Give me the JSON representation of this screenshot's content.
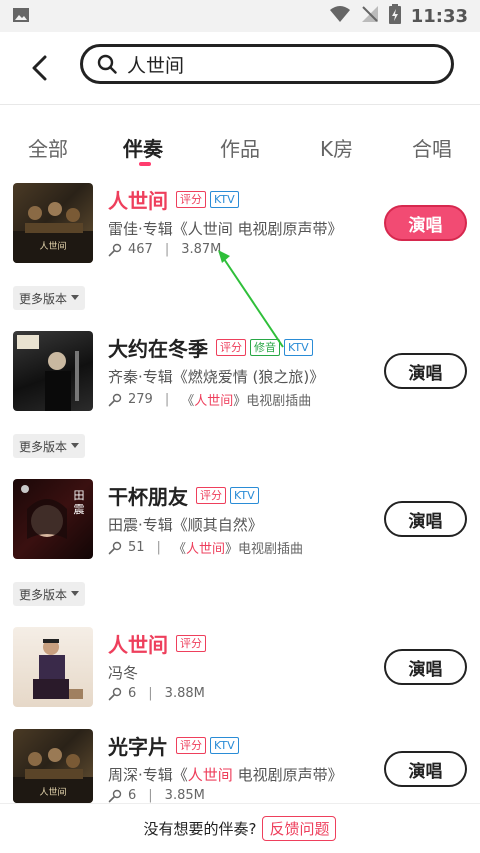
{
  "status_bar": {
    "time": "11:33"
  },
  "search": {
    "query": "人世间"
  },
  "tabs": [
    {
      "label": "全部"
    },
    {
      "label": "伴奏"
    },
    {
      "label": "作品"
    },
    {
      "label": "K房"
    },
    {
      "label": "合唱"
    }
  ],
  "colors": {
    "accent": "#ee3f5c",
    "ktv_blue": "#2a8cd6",
    "fix_green": "#28a745"
  },
  "tags": {
    "score": "评分",
    "ktv": "KTV",
    "fix": "修音"
  },
  "sing_label": "演唱",
  "more_versions_label": "更多版本",
  "songs": [
    {
      "title": "人世间",
      "subtitle": "雷佳·专辑《人世间 电视剧原声带》",
      "plays": "467",
      "size": "3.87M"
    },
    {
      "title": "大约在冬季",
      "subtitle": "齐秦·专辑《燃烧爱情 (狼之旅)》",
      "plays": "279",
      "note_pre": "《",
      "note_hl": "人世间",
      "note_post": "》电视剧插曲"
    },
    {
      "title": "干杯朋友",
      "subtitle": "田震·专辑《顺其自然》",
      "plays": "51",
      "note_pre": "《",
      "note_hl": "人世间",
      "note_post": "》电视剧插曲"
    },
    {
      "title": "人世间",
      "subtitle": "冯冬",
      "plays": "6",
      "size": "3.88M"
    },
    {
      "title": "光字片",
      "subtitle_pre": "周深·专辑《",
      "subtitle_hl": "人世间",
      "subtitle_post": " 电视剧原声带》",
      "plays": "6",
      "size": "3.85M"
    }
  ],
  "footer": {
    "text": "没有想要的伴奏?",
    "feedback": "反馈问题"
  }
}
